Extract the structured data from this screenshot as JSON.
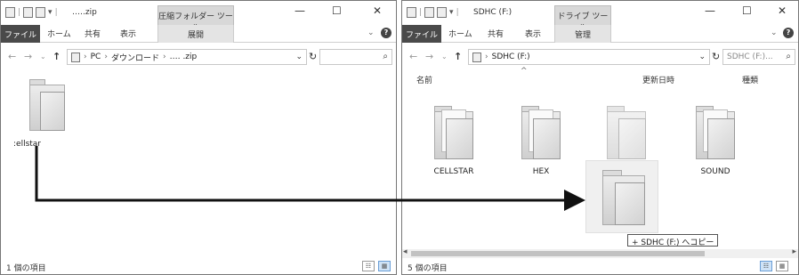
{
  "left_window": {
    "title": "‥‥.zip",
    "context_tab": "圧縮フォルダー ツール",
    "ribbon_tabs": [
      "ファイル",
      "ホーム",
      "共有",
      "表示",
      "展開"
    ],
    "breadcrumb": [
      "PC",
      "ダウンロード",
      "‥‥ .zip"
    ],
    "files": [
      {
        "name": ":ellstar"
      }
    ],
    "status_count": "1 個の項目"
  },
  "right_window": {
    "title": "SDHC (F:)",
    "context_tab": "ドライブ ツール",
    "ribbon_tabs": [
      "ファイル",
      "ホーム",
      "共有",
      "表示",
      "管理"
    ],
    "breadcrumb": [
      "SDHC (F:)"
    ],
    "search_placeholder": "SDHC (F:)...",
    "columns": [
      "名前",
      "更新日時",
      "種類"
    ],
    "folders": [
      {
        "name": "CELLSTAR"
      },
      {
        "name": "HEX"
      },
      {
        "name": ""
      },
      {
        "name": "SOUND"
      }
    ],
    "status_count": "5 個の項目"
  },
  "drag": {
    "tooltip": "+ SDHC (F:) へコピー"
  },
  "window_controls": {
    "minimize": "—",
    "maximize": "☐",
    "close": "✕"
  },
  "icons": {
    "back": "back-arrow-icon",
    "forward": "forward-arrow-icon",
    "up": "up-arrow-icon",
    "refresh": "refresh-icon",
    "search": "search-icon",
    "help": "help-icon",
    "folder": "folder-icon",
    "drive": "drive-icon"
  }
}
